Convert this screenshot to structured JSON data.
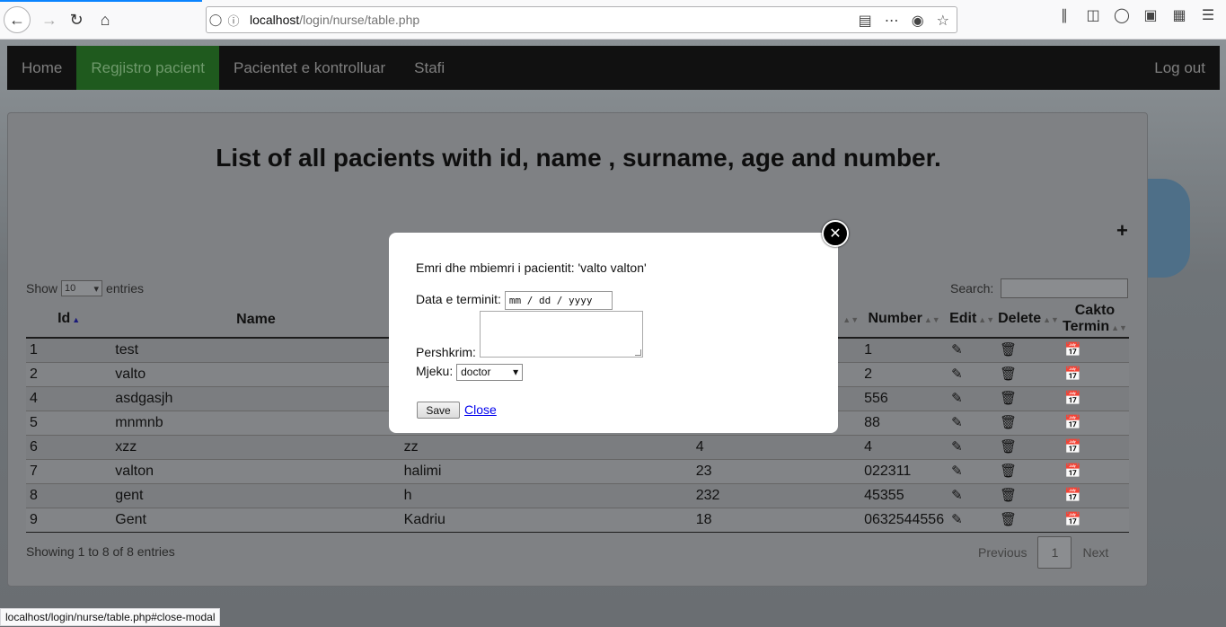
{
  "browser": {
    "url_host": "localhost",
    "url_path": "/login/nurse/table.php",
    "status_url": "localhost/login/nurse/table.php#close-modal"
  },
  "nav": {
    "items": [
      {
        "label": "Home"
      },
      {
        "label": "Regjistro pacient"
      },
      {
        "label": "Pacientet e kontrolluar"
      },
      {
        "label": "Stafi"
      }
    ],
    "logout": "Log out",
    "active_color": "#1f5a1e"
  },
  "panel": {
    "title": "List of all pacients with id, name , surname, age and number.",
    "add_icon": "+",
    "show_label": "Show",
    "entries_value": "10",
    "entries_label": "entries",
    "search_label": "Search:",
    "info": "Showing 1 to 8 of 8 entries",
    "pager": {
      "prev": "Previous",
      "current": "1",
      "next": "Next"
    }
  },
  "table": {
    "headers": [
      "Id",
      "Name",
      "",
      "",
      "Number",
      "Edit",
      "Delete",
      "Cakto Termin"
    ],
    "rows": [
      {
        "id": "1",
        "name": "test",
        "surname": "",
        "age": "",
        "number": "1"
      },
      {
        "id": "2",
        "name": "valto",
        "surname": "",
        "age": "",
        "number": "2"
      },
      {
        "id": "4",
        "name": "asdgasjh",
        "surname": "",
        "age": "",
        "number": "556"
      },
      {
        "id": "5",
        "name": "mnmnb",
        "surname": "",
        "age": "",
        "number": "88"
      },
      {
        "id": "6",
        "name": "xzz",
        "surname": "zz",
        "age": "4",
        "number": "4"
      },
      {
        "id": "7",
        "name": "valton",
        "surname": "halimi",
        "age": "23",
        "number": "022311"
      },
      {
        "id": "8",
        "name": "gent",
        "surname": "h",
        "age": "232",
        "number": "45355"
      },
      {
        "id": "9",
        "name": "Gent",
        "surname": "Kadriu",
        "age": "18",
        "number": "0632544556"
      }
    ]
  },
  "modal": {
    "patient_line": "Emri dhe mbiemri i pacientit: 'valto valton'",
    "date_label": "Data e terminit:",
    "date_placeholder": "mm / dd / yyyy",
    "desc_label": "Pershkrim:",
    "doctor_label": "Mjeku:",
    "doctor_value": "doctor",
    "save": "Save",
    "close": "Close",
    "close_icon": "✕"
  }
}
